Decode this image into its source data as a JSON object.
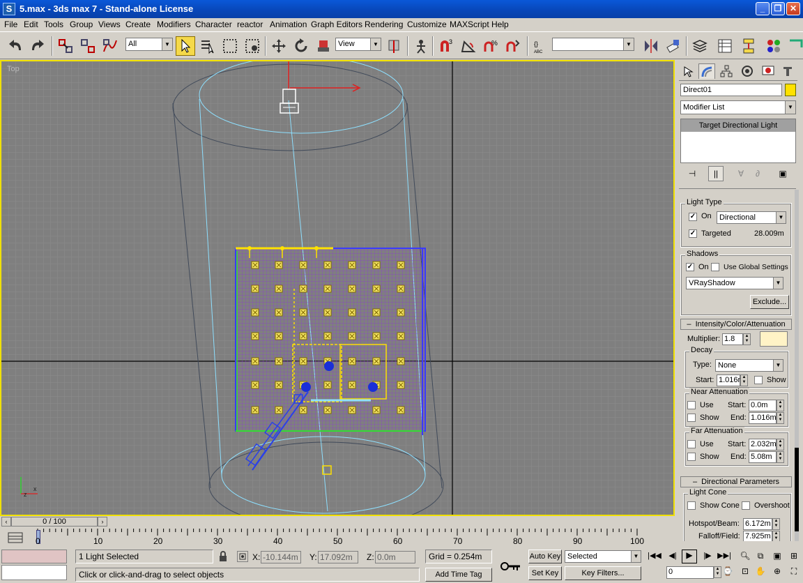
{
  "window": {
    "title": "5.max - 3ds max 7  - Stand-alone License",
    "icon": "3ds-max-icon",
    "min_label": "_",
    "max_label": "❐",
    "close_label": "✕"
  },
  "menu": {
    "items": [
      "File",
      "Edit",
      "Tools",
      "Group",
      "Views",
      "Create",
      "Modifiers",
      "Character",
      "reactor",
      "Animation",
      "Graph Editors",
      "Rendering",
      "Customize",
      "MAXScript",
      "Help"
    ]
  },
  "toolbar": {
    "selection_filter": "All",
    "reference_coord": "View",
    "named_selection": "",
    "snap_angle_label": "3",
    "spinner_snap_label": "%"
  },
  "viewport": {
    "label": "Top"
  },
  "command_panel": {
    "object_name": "Direct01",
    "object_color": "#ffe100",
    "modifier_list": "Modifier List",
    "stack_items": [
      "Target Directional Light"
    ],
    "light_type": {
      "title": "Light Type",
      "on_label": "On",
      "on_checked": "✓",
      "type_value": "Directional",
      "targeted_label": "Targeted",
      "targeted_checked": "✓",
      "target_distance": "28.009m"
    },
    "shadows": {
      "title": "Shadows",
      "on_label": "On",
      "on_checked": "✓",
      "use_global_label": "Use Global Settings",
      "shadow_type": "VRayShadow",
      "exclude_label": "Exclude..."
    },
    "intensity": {
      "header": "Intensity/Color/Attenuation",
      "multiplier_label": "Multiplier:",
      "multiplier_value": "1.8",
      "light_color": "#fff3c6",
      "decay_title": "Decay",
      "decay_type_label": "Type:",
      "decay_type_value": "None",
      "start_label": "Start:",
      "decay_start": "1.016m",
      "show_label": "Show",
      "near_title": "Near Attenuation",
      "use_label": "Use",
      "near_start": "0.0m",
      "end_label": "End:",
      "near_end": "1.016m",
      "far_title": "Far Attenuation",
      "far_start": "2.032m",
      "far_end": "5.08m"
    },
    "directional": {
      "header": "Directional Parameters",
      "cone_title": "Light Cone",
      "show_cone_label": "Show Cone",
      "overshoot_label": "Overshoot",
      "hotspot_label": "Hotspot/Beam:",
      "hotspot_value": "6.172m",
      "falloff_label": "Falloff/Field:",
      "falloff_value": "7.925m"
    }
  },
  "timeline": {
    "slider_label": "0 / 100",
    "ticks": [
      "0",
      "10",
      "20",
      "30",
      "40",
      "50",
      "60",
      "70",
      "80",
      "90",
      "100"
    ]
  },
  "status": {
    "selection": "1 Light Selected",
    "prompt": "Click or click-and-drag to select objects",
    "x_label": "X:",
    "x_value": "-10.144m",
    "y_label": "Y:",
    "y_value": "17.092m",
    "z_label": "Z:",
    "z_value": "0.0m",
    "grid": "Grid = 0.254m",
    "add_time_tag": "Add Time Tag",
    "auto_key": "Auto Key",
    "set_key": "Set Key",
    "key_mode": "Selected",
    "key_filters": "Key Filters...",
    "frame": "0"
  }
}
